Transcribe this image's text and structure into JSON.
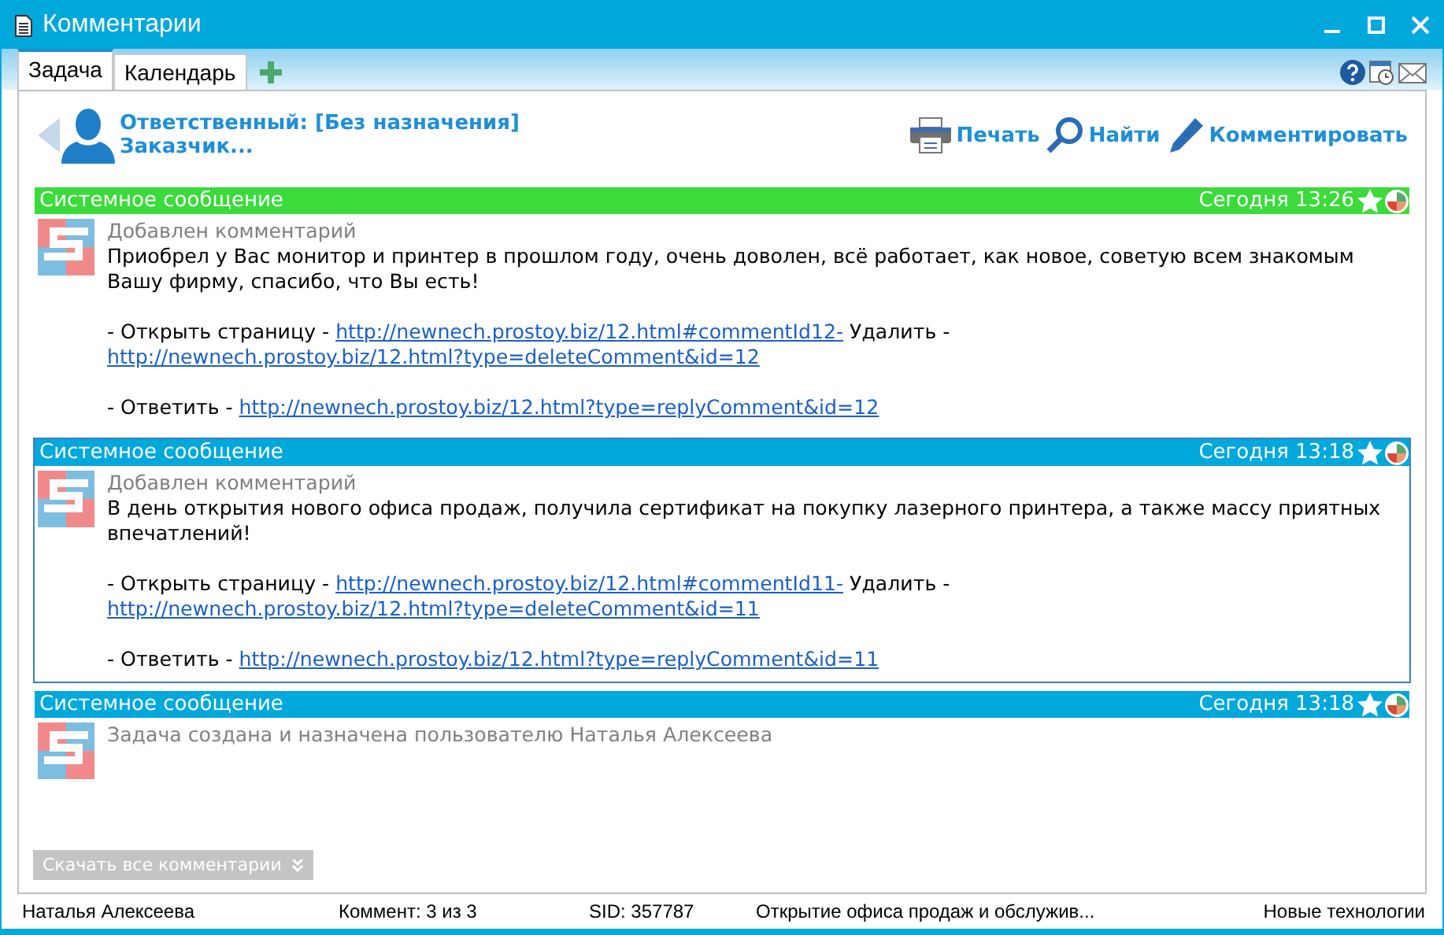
{
  "window": {
    "title": "Комментарии"
  },
  "tabs": [
    {
      "label": "Задача",
      "selected": true
    },
    {
      "label": "Календарь",
      "selected": false
    }
  ],
  "header": {
    "responsible": "Ответственный: [Без назначения]",
    "customer": "Заказчик...",
    "actions": [
      {
        "kind": "print",
        "label": "Печать"
      },
      {
        "kind": "find",
        "label": "Найти"
      },
      {
        "kind": "comment",
        "label": "Комментировать"
      }
    ]
  },
  "messages": [
    {
      "title": "Системное сообщение",
      "time": "Сегодня 13:26",
      "color": "#3adb3a",
      "selected": false,
      "note": "Добавлен комментарий",
      "text": "Приобрел у Вас монитор и принтер в прошлом году, очень доволен, всё работает, как новое, советую всем знакомым Вашу фирму, спасибо, что Вы есть!",
      "lines": [
        [
          {
            "kind": "text",
            "text": "- Открыть страницу - "
          },
          {
            "kind": "link",
            "text": "http://newnech.prostoy.biz/12.html#commentId12-"
          },
          {
            "kind": "text",
            "text": " Удалить - "
          },
          {
            "kind": "link",
            "text": "http://newnech.prostoy.biz/12.html?type=deleteComment&id=12"
          }
        ],
        [
          {
            "kind": "text",
            "text": "- Ответить - "
          },
          {
            "kind": "link",
            "text": "http://newnech.prostoy.biz/12.html?type=replyComment&id=12"
          }
        ]
      ]
    },
    {
      "title": "Системное сообщение",
      "time": "Сегодня 13:18",
      "color": "#00a8dc",
      "selected": true,
      "note": "Добавлен комментарий",
      "text": "В день открытия нового офиса продаж, получила сертификат на покупку лазерного принтера, а также массу приятных впечатлений!",
      "lines": [
        [
          {
            "kind": "text",
            "text": "- Открыть страницу - "
          },
          {
            "kind": "link",
            "text": "http://newnech.prostoy.biz/12.html#commentId11-"
          },
          {
            "kind": "text",
            "text": " Удалить - "
          },
          {
            "kind": "link",
            "text": "http://newnech.prostoy.biz/12.html?type=deleteComment&id=11"
          }
        ],
        [
          {
            "kind": "text",
            "text": "- Ответить - "
          },
          {
            "kind": "link",
            "text": "http://newnech.prostoy.biz/12.html?type=replyComment&id=11"
          }
        ]
      ]
    },
    {
      "title": "Системное сообщение",
      "time": "Сегодня 13:18",
      "color": "#00a8dc",
      "selected": false,
      "note": "Задача создана и назначена пользователю Наталья Алексеева"
    }
  ],
  "download_button": "Скачать все комментарии",
  "status_bar": [
    "Наталья Алексеева",
    "Коммент: 3 из 3",
    "SID: 357787",
    "Открытие офиса продаж и обслужив...",
    "Новые технологии"
  ]
}
